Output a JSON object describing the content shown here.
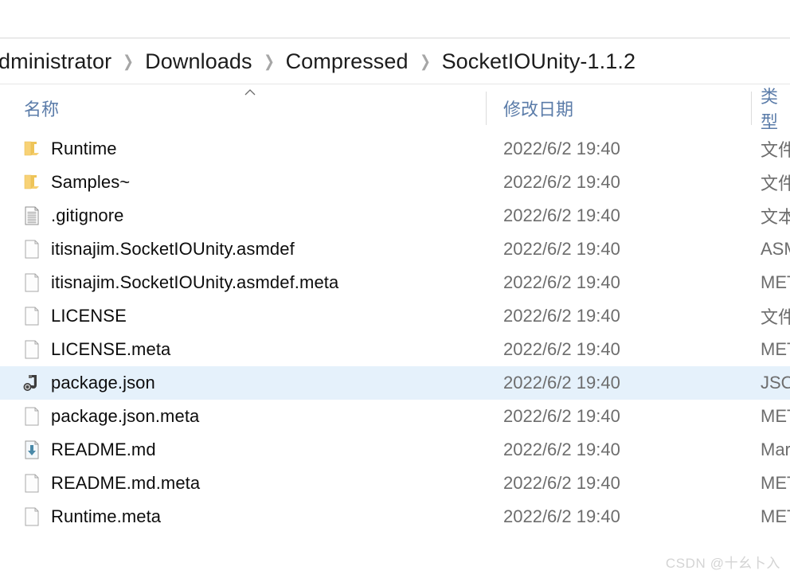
{
  "window": {
    "breadcrumb": {
      "separator": "❯",
      "items": [
        {
          "label": "dministrator"
        },
        {
          "label": "Downloads"
        },
        {
          "label": "Compressed"
        },
        {
          "label": "SocketIOUnity-1.1.2"
        }
      ]
    }
  },
  "columns": {
    "sort_indicator": "︿",
    "sort_column": "name",
    "headers": [
      {
        "key": "name",
        "label": "名称"
      },
      {
        "key": "date",
        "label": "修改日期"
      },
      {
        "key": "type",
        "label": "类型"
      }
    ]
  },
  "files": [
    {
      "name": "Runtime",
      "date": "2022/6/2 19:40",
      "type": "文件",
      "icon": "folder-icon",
      "selected": false
    },
    {
      "name": "Samples~",
      "date": "2022/6/2 19:40",
      "type": "文件",
      "icon": "folder-icon",
      "selected": false
    },
    {
      "name": ".gitignore",
      "date": "2022/6/2 19:40",
      "type": "文本",
      "icon": "text-file-icon",
      "selected": false
    },
    {
      "name": "itisnajim.SocketIOUnity.asmdef",
      "date": "2022/6/2 19:40",
      "type": "ASM",
      "icon": "blank-file-icon",
      "selected": false
    },
    {
      "name": "itisnajim.SocketIOUnity.asmdef.meta",
      "date": "2022/6/2 19:40",
      "type": "MET",
      "icon": "blank-file-icon",
      "selected": false
    },
    {
      "name": "LICENSE",
      "date": "2022/6/2 19:40",
      "type": "文件",
      "icon": "blank-file-icon",
      "selected": false
    },
    {
      "name": "LICENSE.meta",
      "date": "2022/6/2 19:40",
      "type": "MET",
      "icon": "blank-file-icon",
      "selected": false
    },
    {
      "name": "package.json",
      "date": "2022/6/2 19:40",
      "type": "JSO",
      "icon": "json-file-icon",
      "selected": true
    },
    {
      "name": "package.json.meta",
      "date": "2022/6/2 19:40",
      "type": "MET",
      "icon": "blank-file-icon",
      "selected": false
    },
    {
      "name": "README.md",
      "date": "2022/6/2 19:40",
      "type": "Mar",
      "icon": "markdown-file-icon",
      "selected": false
    },
    {
      "name": "README.md.meta",
      "date": "2022/6/2 19:40",
      "type": "MET",
      "icon": "blank-file-icon",
      "selected": false
    },
    {
      "name": "Runtime.meta",
      "date": "2022/6/2 19:40",
      "type": "MET",
      "icon": "blank-file-icon",
      "selected": false
    }
  ],
  "watermark": {
    "text": "CSDN @十幺卜入"
  },
  "colors": {
    "header_text": "#5b7ca9",
    "selection": "#e5f1fb",
    "folder": "#fbd26b",
    "markdown_arrow": "#4a89a8",
    "secondary_text": "#6d6d6d"
  }
}
